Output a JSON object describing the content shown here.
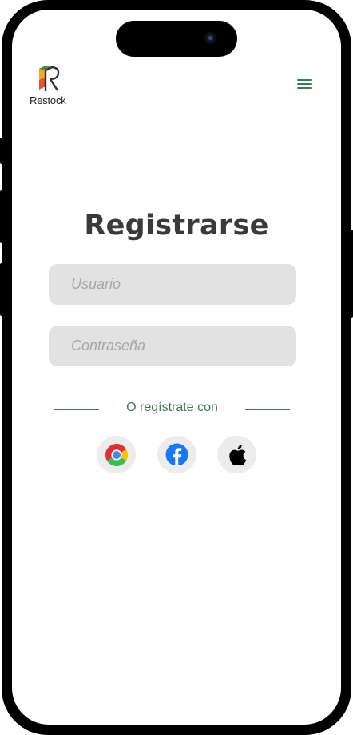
{
  "header": {
    "brand": "Restock",
    "logo_colors": [
      "#e8532d",
      "#f5a623",
      "#4a8a3f",
      "#333333"
    ],
    "menu_icon": "hamburger-icon"
  },
  "form": {
    "title": "Registrarse",
    "username_placeholder": "Usuario",
    "password_placeholder": "Contraseña"
  },
  "social": {
    "divider_text": "O regístrate con",
    "providers": [
      {
        "name": "Google Chrome",
        "icon": "chrome-icon"
      },
      {
        "name": "Facebook",
        "icon": "facebook-icon"
      },
      {
        "name": "Apple",
        "icon": "apple-icon"
      }
    ]
  },
  "colors": {
    "accent_green": "#3f7a4f",
    "input_bg": "#e2e2e2",
    "title": "#3a3a3a"
  }
}
